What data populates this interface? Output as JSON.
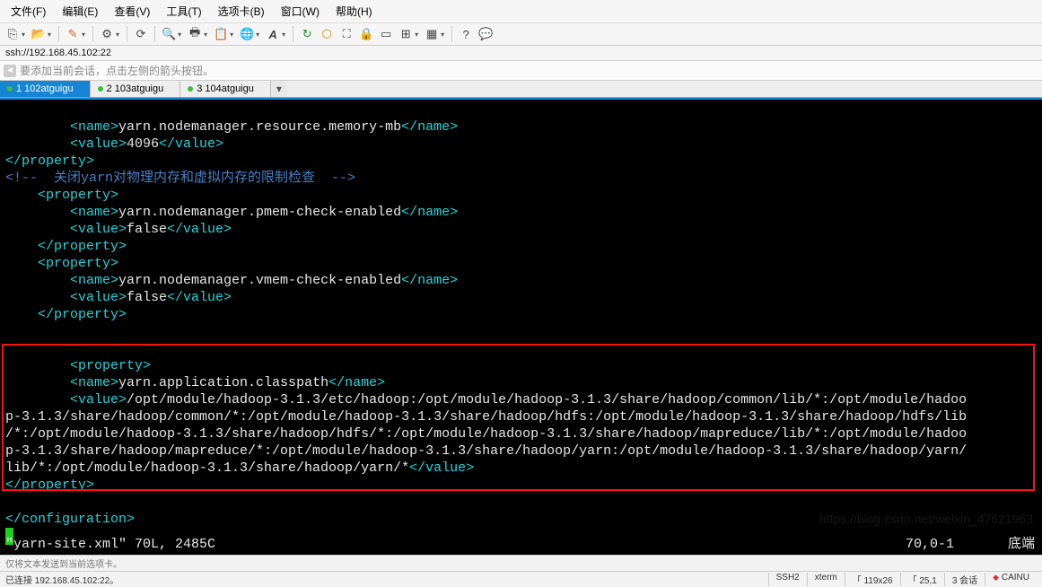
{
  "menubar": {
    "items": [
      "文件(F)",
      "编辑(E)",
      "查看(V)",
      "工具(T)",
      "选项卡(B)",
      "窗口(W)",
      "帮助(H)"
    ]
  },
  "pathbar": {
    "label": "ssh://192.168.45.102:22"
  },
  "hintbar": {
    "text": "要添加当前会话，点击左侧的箭头按钮。"
  },
  "tabs": {
    "items": [
      {
        "label": "1 102atguigu",
        "active": true
      },
      {
        "label": "2 103atguigu",
        "active": false
      },
      {
        "label": "3 104atguigu",
        "active": false
      }
    ]
  },
  "terminal": {
    "lines_raw": "rendered below",
    "vim_status_left": "\"yarn-site.xml\" 70L, 2485C",
    "vim_status_pos": "70,0-1",
    "vim_status_right": "底端"
  },
  "code": {
    "l1_open": "<name>",
    "l1_text": "yarn.nodemanager.resource.memory-mb",
    "l1_close": "</name>",
    "l2_open": "<value>",
    "l2_text": "4096",
    "l2_close": "</value>",
    "l3": "</property>",
    "l4": "<!--  关闭yarn对物理内存和虚拟内存的限制检查  -->",
    "l5": "<property>",
    "l6_open": "<name>",
    "l6_text": "yarn.nodemanager.pmem-check-enabled",
    "l6_close": "</name>",
    "l7_open": "<value>",
    "l7_text": "false",
    "l7_close": "</value>",
    "l8": "</property>",
    "l9": "<property>",
    "l10_open": "<name>",
    "l10_text": "yarn.nodemanager.vmem-check-enabled",
    "l10_close": "</name>",
    "l11_open": "<value>",
    "l11_text": "false",
    "l11_close": "</value>",
    "l12": "</property>",
    "l14": "<property>",
    "l15_open": "<name>",
    "l15_text": "yarn.application.classpath",
    "l15_close": "</name>",
    "l16_open": "<value>",
    "l16_text_a": "/opt/module/hadoop-3.1.3/etc/hadoop:/opt/module/hadoop-3.1.3/share/hadoop/common/lib/*:/opt/module/hadoo",
    "l16_text_b": "p-3.1.3/share/hadoop/common/*:/opt/module/hadoop-3.1.3/share/hadoop/hdfs:/opt/module/hadoop-3.1.3/share/hadoop/hdfs/lib",
    "l16_text_c": "/*:/opt/module/hadoop-3.1.3/share/hadoop/hdfs/*:/opt/module/hadoop-3.1.3/share/hadoop/mapreduce/lib/*:/opt/module/hadoo",
    "l16_text_d": "p-3.1.3/share/hadoop/mapreduce/*:/opt/module/hadoop-3.1.3/share/hadoop/yarn:/opt/module/hadoop-3.1.3/share/hadoop/yarn/",
    "l16_text_e": "lib/*:/opt/module/hadoop-3.1.3/share/hadoop/yarn/*",
    "l16_close": "</value>",
    "l17": "</property>",
    "l19": "</configuration>"
  },
  "footer": {
    "line1": "仅将文本发送到当前选项卡。",
    "line2_left": "已连接 192.168.45.102:22。",
    "segs": [
      "SSH2",
      "xterm",
      "「 119x26",
      "「 25,1",
      "3 会话",
      "CAINU"
    ],
    "red_bullet": "◆"
  },
  "watermark": "https://blog.csdn.net/weixin_47621963",
  "icons": {
    "new": "⎘",
    "open": "📂",
    "copy": "📋",
    "pencil": "✎",
    "gear": "⚙",
    "reload": "⟳",
    "search": "🔍",
    "print": "🖶",
    "clip": "📋",
    "globe": "🌐",
    "font": "A",
    "cycle": "↻",
    "badge": "⬡",
    "max": "⛶",
    "lock": "🔒",
    "box": "▭",
    "plus": "⊞",
    "grid": "▦",
    "help": "?",
    "chat": "💬"
  }
}
